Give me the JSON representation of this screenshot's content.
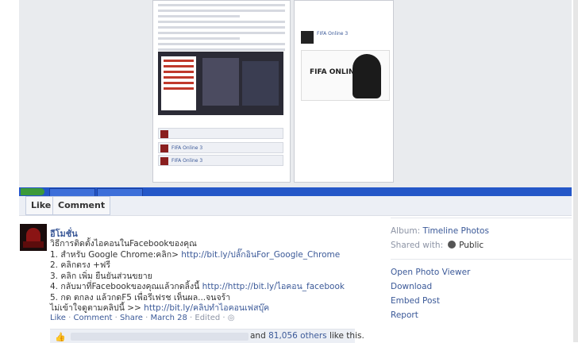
{
  "photo": {
    "fifa_card": {
      "title": "FIFA Online 3",
      "banner_logo": "FIFA ONLINE 3"
    }
  },
  "actions": {
    "like_label": "Like",
    "comment_label": "Comment"
  },
  "post": {
    "author": "อีโมชั่น",
    "lines": [
      {
        "text": "วิธีการติดตั้งไอคอนในFacebookของคุณ",
        "link": ""
      },
      {
        "text": "1. สำหรับ Google Chrome:คลิก> ",
        "link": "http://bit.ly/ปลั๊กอินFor_Google_Chrome"
      },
      {
        "text": "2. คลิกตรง +ฟรี",
        "link": ""
      },
      {
        "text": "3. คลิก เพิ่ม ยืนยันส่วนขยาย",
        "link": ""
      },
      {
        "text": "4. กลับมาที่Facebookของคุณแล้วกดลิ้งนี้ ",
        "link": "http://http://bit.ly/ไอคอน_facebook"
      },
      {
        "text": "5. กด ตกลง แล้วกดF5 เพื่อรีเฟรช เห็นผล...จนจร้า",
        "link": ""
      },
      {
        "text": "ไม่เข้าใจดูตามคลิปนี้ >> ",
        "link": "http://bit.ly/คลิปทำไอคอนเฟสบุ๊ค"
      }
    ],
    "meta": {
      "like": "Like",
      "comment": "Comment",
      "share": "Share",
      "date": "March 28",
      "edited": "Edited",
      "sep": " · "
    },
    "likes": {
      "thumb_icon": "thumbs-up-icon",
      "count_link": "81,056 others",
      "prefix": "and ",
      "suffix": " like this."
    }
  },
  "sidebar": {
    "album_label": "Album: ",
    "album_value": "Timeline Photos",
    "shared_label": "Shared with:",
    "shared_value": "Public",
    "shared_icon": "globe-icon",
    "links": [
      "Open Photo Viewer",
      "Download",
      "Embed Post",
      "Report"
    ]
  },
  "colors": {
    "link": "#3b5998",
    "muted": "#8d94a5",
    "bar": "#eceff5"
  }
}
